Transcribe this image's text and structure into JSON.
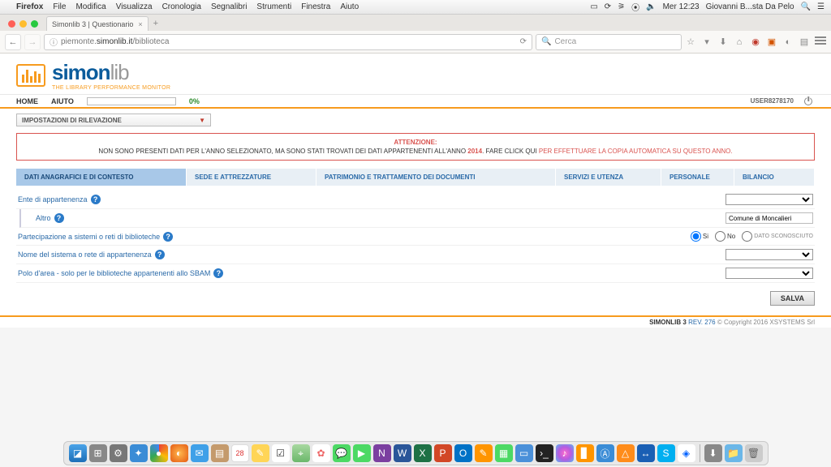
{
  "mac_menu": {
    "app": "Firefox",
    "items": [
      "File",
      "Modifica",
      "Visualizza",
      "Cronologia",
      "Segnalibri",
      "Strumenti",
      "Finestra",
      "Aiuto"
    ],
    "clock": "Mer 12:23",
    "user": "Giovanni B...sta Da Pelo"
  },
  "browser": {
    "tab_title": "Simonlib 3 | Questionario",
    "url_prefix": "piemonte.",
    "url_domain": "simonlib.it",
    "url_path": "/biblioteca",
    "search_placeholder": "Cerca"
  },
  "brand": {
    "name_a": "simon",
    "name_b": "lib",
    "tagline": "THE LIBRARY PERFORMANCE MONITOR"
  },
  "nav": {
    "home": "HOME",
    "help": "AIUTO",
    "pct": "0%",
    "user_code": "USER8278170"
  },
  "settings_dd": "IMPOSTAZIONI DI RILEVAZIONE",
  "alert": {
    "title": "ATTENZIONE:",
    "p1": "NON SONO PRESENTI DATI PER L'ANNO SELEZIONATO, MA SONO STATI TROVATI DEI DATI APPARTENENTI ALL'ANNO ",
    "year": "2014",
    "p2": ". FARE CLICK QUI ",
    "link": "PER EFFETTUARE LA COPIA AUTOMATICA SU QUESTO ANNO."
  },
  "tabs": {
    "t1": "DATI ANAGRAFICI E DI CONTESTO",
    "t2": "SEDE E ATTREZZATURE",
    "t3": "PATRIMONIO E TRATTAMENTO DEI DOCUMENTI",
    "t4": "SERVIZI E UTENZA",
    "t5": "PERSONALE",
    "t6": "BILANCIO"
  },
  "form": {
    "ente": "Ente di appartenenza",
    "altro": "Altro",
    "altro_value": "Comune di Moncalieri",
    "partecipazione": "Partecipazione a sistemi o reti di biblioteche",
    "opt_si": "Si",
    "opt_no": "No",
    "opt_unk": "DATO SCONOSCIUTO",
    "nome_sistema": "Nome del sistema o rete di appartenenza",
    "polo": "Polo d'area - solo per le biblioteche appartenenti allo SBAM",
    "save": "SALVA"
  },
  "footer": {
    "app": "SIMONLIB 3",
    "rev": "REV. 276",
    "copy": "© Copyright 2016 XSYSTEMS Srl"
  }
}
